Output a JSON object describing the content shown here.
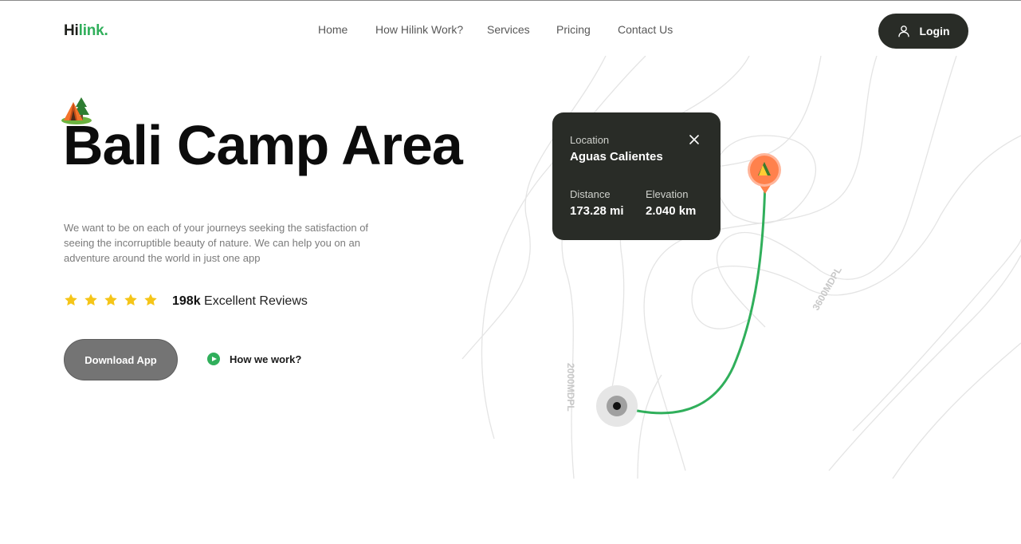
{
  "header": {
    "logo_part1": "Hi",
    "logo_part2": "link.",
    "nav": [
      "Home",
      "How Hilink Work?",
      "Services",
      "Pricing",
      "Contact Us"
    ],
    "login_label": "Login"
  },
  "hero": {
    "title": "Bali Camp Area",
    "description": "We want to be on each of your journeys seeking the satisfaction of seeing the incorruptible beauty of nature. We can help you on an adventure around the world in just one app",
    "rating": 5,
    "review_count": "198k",
    "review_label": "Excellent Reviews",
    "download_label": "Download App",
    "how_label": "How we work?"
  },
  "map": {
    "contour_label_1": "2000MDPL",
    "contour_label_2": "3600MDPL",
    "card": {
      "location_label": "Location",
      "location_value": "Aguas Calientes",
      "distance_label": "Distance",
      "distance_value": "173.28 mi",
      "elevation_label": "Elevation",
      "elevation_value": "2.040 km"
    }
  },
  "colors": {
    "accent": "#30af5b",
    "dark": "#292c27",
    "star": "#f5c518",
    "pin": "#ff814c"
  },
  "icons": {
    "login": "user-icon",
    "camp": "camp-tent-icon",
    "play": "play-circle-icon",
    "close": "close-icon",
    "star": "star-icon",
    "pin": "map-pin-icon"
  }
}
